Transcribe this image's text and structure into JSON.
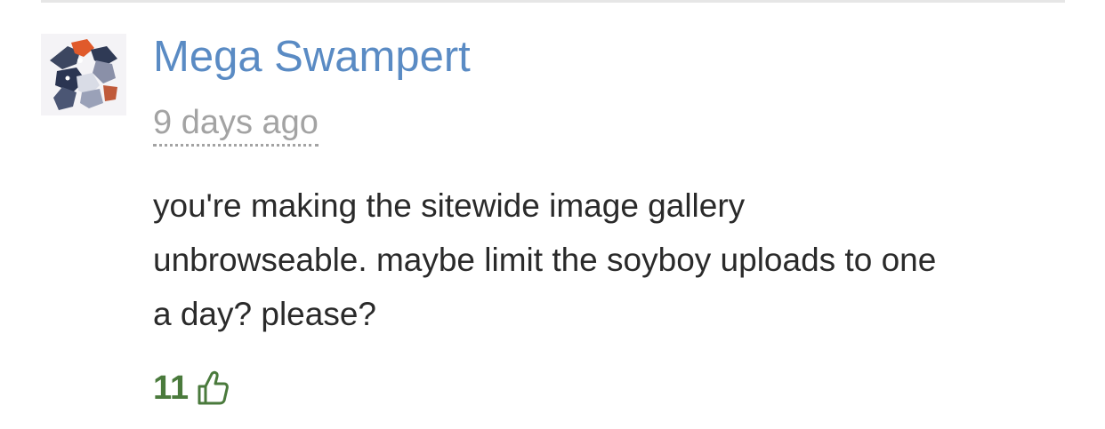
{
  "comment": {
    "author": "Mega Swampert",
    "timestamp": "9 days ago",
    "lines": [
      "you're making the sitewide image gallery",
      "unbrowseable. maybe limit the soyboy uploads to one",
      "a day? please?"
    ],
    "votes": "11",
    "vote_icon": "thumbs-up-icon"
  },
  "colors": {
    "author_link": "#5a8bc4",
    "timestamp": "#a3a3a3",
    "body_text": "#2a2a2a",
    "vote_green": "#4a7a3c",
    "divider": "#e6e6e6"
  }
}
